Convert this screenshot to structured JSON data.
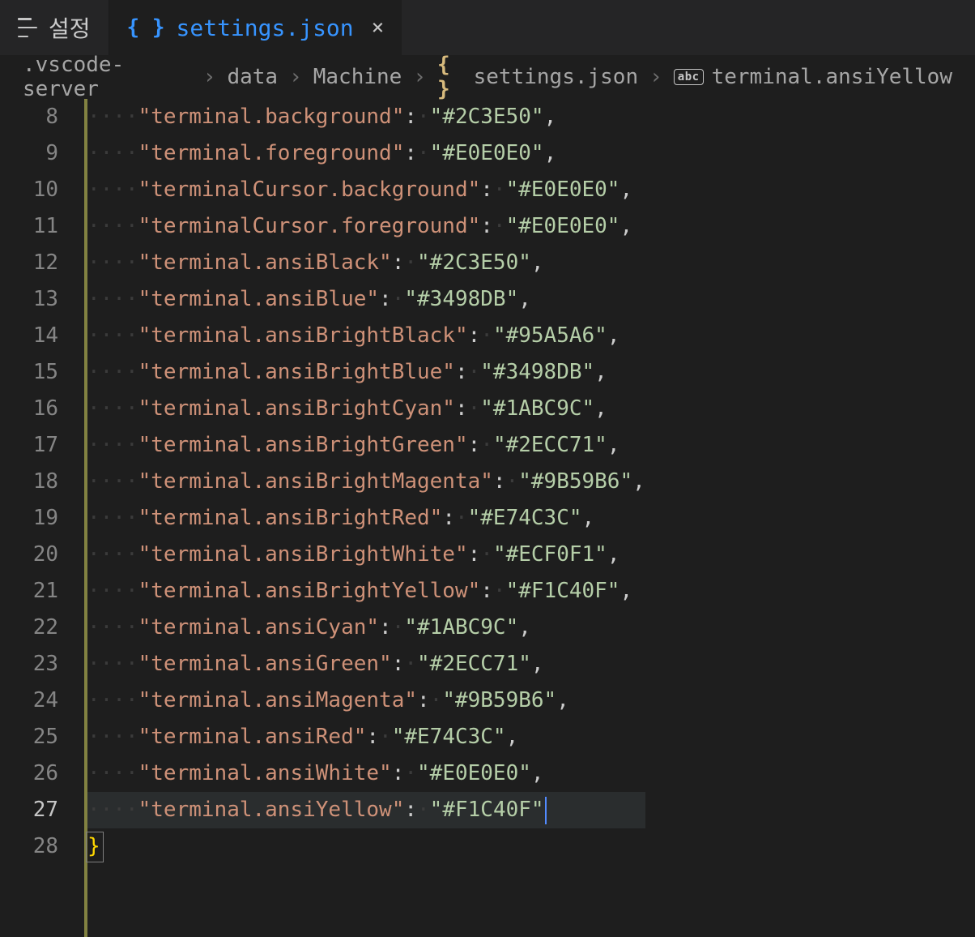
{
  "tabs": {
    "settings_label": "설정",
    "active_label": "settings.json"
  },
  "breadcrumb": {
    "seg0": ".vscode-server",
    "seg1": "data",
    "seg2": "Machine",
    "seg3": "settings.json",
    "seg4": "terminal.ansiYellow"
  },
  "lines": [
    {
      "num": "8",
      "key": "terminal.background",
      "value": "#2C3E50",
      "comma": true
    },
    {
      "num": "9",
      "key": "terminal.foreground",
      "value": "#E0E0E0",
      "comma": true
    },
    {
      "num": "10",
      "key": "terminalCursor.background",
      "value": "#E0E0E0",
      "comma": true
    },
    {
      "num": "11",
      "key": "terminalCursor.foreground",
      "value": "#E0E0E0",
      "comma": true
    },
    {
      "num": "12",
      "key": "terminal.ansiBlack",
      "value": "#2C3E50",
      "comma": true
    },
    {
      "num": "13",
      "key": "terminal.ansiBlue",
      "value": "#3498DB",
      "comma": true
    },
    {
      "num": "14",
      "key": "terminal.ansiBrightBlack",
      "value": "#95A5A6",
      "comma": true
    },
    {
      "num": "15",
      "key": "terminal.ansiBrightBlue",
      "value": "#3498DB",
      "comma": true
    },
    {
      "num": "16",
      "key": "terminal.ansiBrightCyan",
      "value": "#1ABC9C",
      "comma": true
    },
    {
      "num": "17",
      "key": "terminal.ansiBrightGreen",
      "value": "#2ECC71",
      "comma": true
    },
    {
      "num": "18",
      "key": "terminal.ansiBrightMagenta",
      "value": "#9B59B6",
      "comma": true
    },
    {
      "num": "19",
      "key": "terminal.ansiBrightRed",
      "value": "#E74C3C",
      "comma": true
    },
    {
      "num": "20",
      "key": "terminal.ansiBrightWhite",
      "value": "#ECF0F1",
      "comma": true
    },
    {
      "num": "21",
      "key": "terminal.ansiBrightYellow",
      "value": "#F1C40F",
      "comma": true
    },
    {
      "num": "22",
      "key": "terminal.ansiCyan",
      "value": "#1ABC9C",
      "comma": true
    },
    {
      "num": "23",
      "key": "terminal.ansiGreen",
      "value": "#2ECC71",
      "comma": true
    },
    {
      "num": "24",
      "key": "terminal.ansiMagenta",
      "value": "#9B59B6",
      "comma": true
    },
    {
      "num": "25",
      "key": "terminal.ansiRed",
      "value": "#E74C3C",
      "comma": true
    },
    {
      "num": "26",
      "key": "terminal.ansiWhite",
      "value": "#E0E0E0",
      "comma": true
    },
    {
      "num": "27",
      "key": "terminal.ansiYellow",
      "value": "#F1C40F",
      "comma": false
    }
  ],
  "closing_line_num": "28",
  "closing_brace": "}",
  "glyph": {
    "abc": "abc",
    "close": "×",
    "chevron": "›"
  }
}
